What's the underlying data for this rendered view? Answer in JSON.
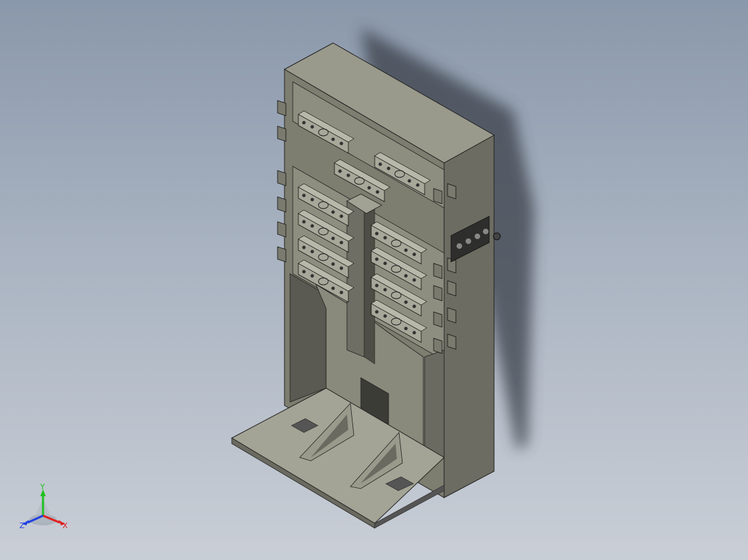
{
  "viewport": {
    "background_top": "#8a98ab",
    "background_bottom": "#c9ced6"
  },
  "model": {
    "body_color": "#8a8a7c",
    "shadow_color": "#3a3f48"
  },
  "triad": {
    "x_label": "X",
    "y_label": "Y",
    "z_label": "Z",
    "x_color": "#e02020",
    "y_color": "#20c020",
    "z_color": "#2040e0"
  }
}
